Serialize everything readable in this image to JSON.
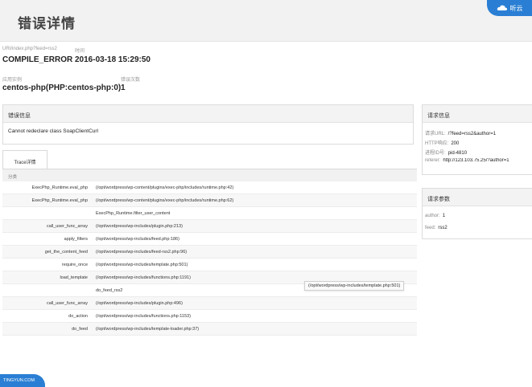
{
  "header": {
    "title": "错误详情",
    "logo_text": "听云"
  },
  "summary": {
    "url_label": "URI/index.php?feed=rss2",
    "url_value": "COMPILE_ERROR",
    "time_label": "时间",
    "time_value": "2016-03-18 15:29:50",
    "app_label": "应用实例",
    "app_value": "centos-php(PHP:centos-php:0)",
    "count_label": "错误次数",
    "count_value": "1"
  },
  "error_panel": {
    "title": "错误信息",
    "message": "Cannot redeclare class SoapClientCurl"
  },
  "request_info": {
    "title": "请求信息",
    "rows": [
      {
        "key": "请求URL:",
        "value": "/?feed=rss2&author=1"
      },
      {
        "key": "HTTP响应:",
        "value": "200"
      },
      {
        "key": "进程ID号:",
        "value": "pid-4810"
      },
      {
        "key": "referer:",
        "value": "http://123.103.75.25/?author=1"
      }
    ]
  },
  "request_params": {
    "title": "请求参数",
    "rows": [
      {
        "key": "author:",
        "value": "1"
      },
      {
        "key": "feed:",
        "value": "rss2"
      }
    ]
  },
  "trace": {
    "tab_label": "Trace详情",
    "header": "分类",
    "rows": [
      {
        "fn": "ExecPhp_Runtime.eval_php",
        "path": "(/opt/wordpress/wp-content/plugins/exec-php/includes/runtime.php:42)"
      },
      {
        "fn": "ExecPhp_Runtime.eval_php",
        "path": "(/opt/wordpress/wp-content/plugins/exec-php/includes/runtime.php:62)"
      },
      {
        "fn": "",
        "path": "ExecPhp_Runtime.filter_user_content"
      },
      {
        "fn": "call_user_func_array",
        "path": "(/opt/wordpress/wp-includes/plugin.php:213)"
      },
      {
        "fn": "apply_filters",
        "path": "(/opt/wordpress/wp-includes/feed.php:186)"
      },
      {
        "fn": "get_the_content_feed",
        "path": "(/opt/wordpress/wp-includes/feed-rss2.php:96)"
      },
      {
        "fn": "require_once",
        "path": "(/opt/wordpress/wp-includes/template.php:501)"
      },
      {
        "fn": "load_template",
        "path": "(/opt/wordpress/wp-includes/functions.php:1191)"
      },
      {
        "fn": "",
        "path": "do_feed_rss2"
      },
      {
        "fn": "call_user_func_array",
        "path": "(/opt/wordpress/wp-includes/plugin.php:496)"
      },
      {
        "fn": "do_action",
        "path": "(/opt/wordpress/wp-includes/functions.php:1153)"
      },
      {
        "fn": "do_feed",
        "path": "(/opt/wordpress/wp-includes/template-loader.php:37)"
      }
    ]
  },
  "tooltip": "(/opt/wordpress/wp-includes/template.php:501)",
  "footer": {
    "text": "TINGYUN.COM"
  },
  "colors": {
    "brand": "#2a7fd4",
    "panel_head": "#f3f3f3"
  }
}
